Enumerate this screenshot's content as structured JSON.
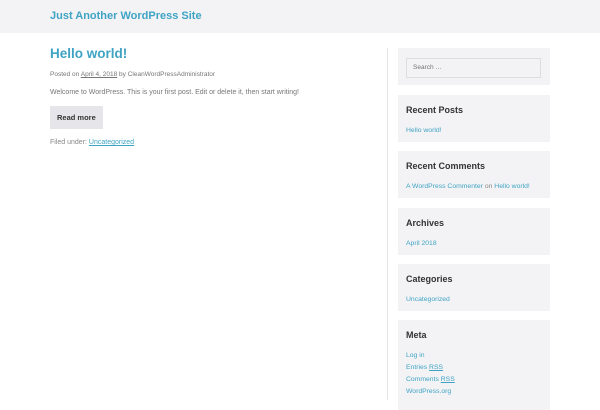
{
  "site": {
    "title": "Just Another WordPress Site"
  },
  "post": {
    "title": "Hello world!",
    "posted_on": "Posted on",
    "date": "April 4, 2018",
    "by": "by",
    "author": "CleanWordPressAdministrator",
    "excerpt": "Welcome to WordPress. This is your first post. Edit or delete it, then start writing!",
    "read_more": "Read more",
    "filed_under": "Filed under:",
    "category": "Uncategorized"
  },
  "sidebar": {
    "search_placeholder": "Search …",
    "recent_posts": {
      "title": "Recent Posts",
      "items": [
        "Hello world!"
      ]
    },
    "recent_comments": {
      "title": "Recent Comments",
      "commenter": "A WordPress Commenter",
      "on": "on",
      "post": "Hello world!"
    },
    "archives": {
      "title": "Archives",
      "items": [
        "April 2018"
      ]
    },
    "categories": {
      "title": "Categories",
      "items": [
        "Uncategorized"
      ]
    },
    "meta": {
      "title": "Meta",
      "login": "Log in",
      "entries": "Entries",
      "comments": "Comments",
      "rss": "RSS",
      "wporg": "WordPress.org"
    }
  }
}
